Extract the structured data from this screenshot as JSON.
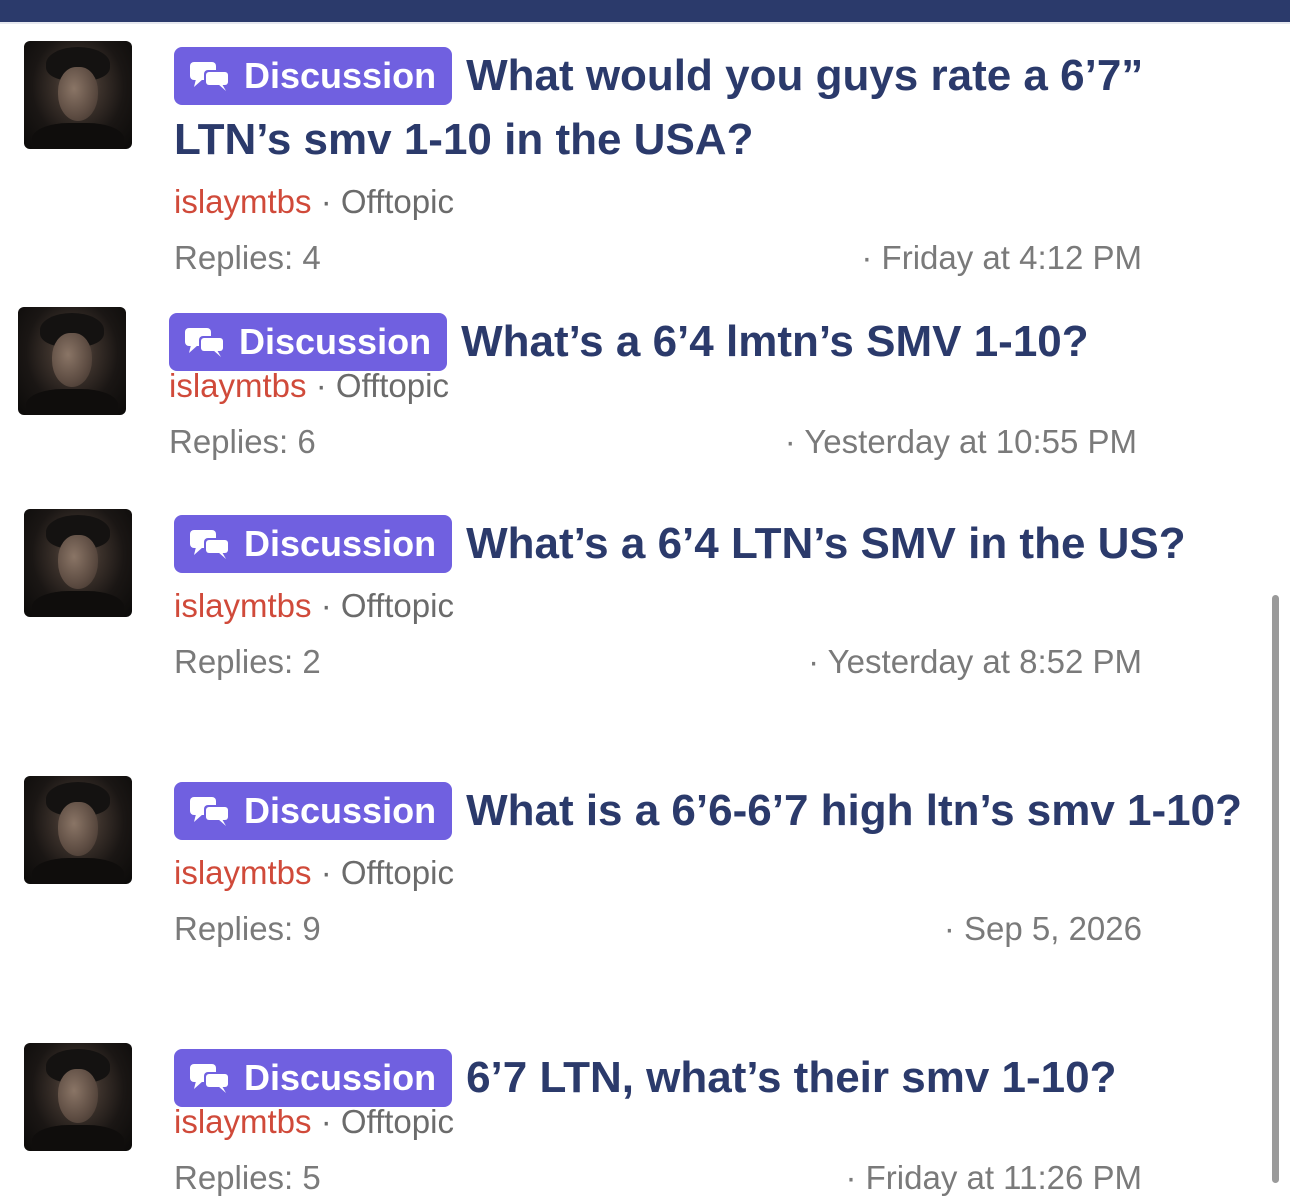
{
  "threads": [
    {
      "badge": "Discussion",
      "title": "What would you guys rate a 6’7” LTN’s smv 1-10 in the USA?",
      "author": "islaymtbs",
      "separator": " · ",
      "forum": "Offtopic",
      "replies": "Replies: 4",
      "date": "· Friday at 4:12 PM"
    },
    {
      "badge": "Discussion",
      "title": "What’s a 6’4 lmtn’s SMV 1-10?",
      "author": "islaymtbs",
      "separator": " · ",
      "forum": "Offtopic",
      "replies": "Replies: 6",
      "date": "· Yesterday at 10:55 PM"
    },
    {
      "badge": "Discussion",
      "title": "What’s a 6’4 LTN’s SMV in the US?",
      "author": "islaymtbs",
      "separator": " · ",
      "forum": "Offtopic",
      "replies": "Replies: 2",
      "date": "· Yesterday at 8:52 PM"
    },
    {
      "badge": "Discussion",
      "title": "What is a 6’6-6’7 high ltn’s smv 1-10?",
      "author": "islaymtbs",
      "separator": " · ",
      "forum": "Offtopic",
      "replies": "Replies: 9",
      "date": "· Sep 5, 2026"
    },
    {
      "badge": "Discussion",
      "title": "6’7 LTN, what’s their smv 1-10?",
      "author": "islaymtbs",
      "separator": " · ",
      "forum": "Offtopic",
      "replies": "Replies: 5",
      "date": "· Friday at 11:26 PM"
    }
  ],
  "colors": {
    "header_bar": "#2b3a6b",
    "title": "#2b3a6b",
    "badge": "#7060e0",
    "author": "#d04a3a",
    "meta": "#6b6b6b"
  },
  "icons": {
    "badge_icon": "chat-bubbles-icon"
  }
}
